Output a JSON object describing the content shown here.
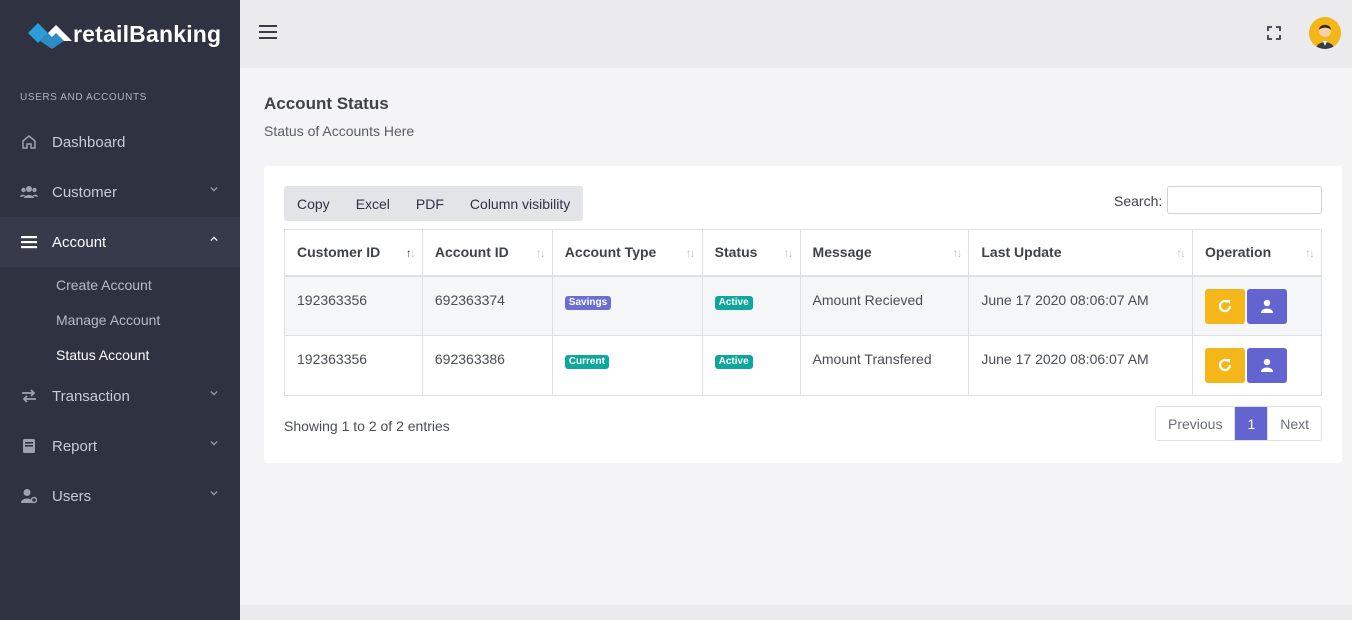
{
  "brand": {
    "name": "retailBanking",
    "accent": "#2d9cdb"
  },
  "sidebar": {
    "section_label": "USERS AND ACCOUNTS",
    "items": [
      {
        "label": "Dashboard",
        "icon": "home-icon"
      },
      {
        "label": "Customer",
        "icon": "users-group-icon"
      },
      {
        "label": "Account",
        "icon": "menu-bars-icon"
      },
      {
        "label": "Transaction",
        "icon": "exchange-icon"
      },
      {
        "label": "Report",
        "icon": "book-icon"
      },
      {
        "label": "Users",
        "icon": "user-cog-icon"
      }
    ],
    "account_sub": [
      {
        "label": "Create Account"
      },
      {
        "label": "Manage Account"
      },
      {
        "label": "Status Account"
      }
    ]
  },
  "page": {
    "title": "Account Status",
    "subtitle": "Status of Accounts Here"
  },
  "toolbar": {
    "copy": "Copy",
    "excel": "Excel",
    "pdf": "PDF",
    "column_visibility": "Column visibility",
    "search_label": "Search:",
    "search_value": ""
  },
  "table": {
    "headers": [
      "Customer ID",
      "Account ID",
      "Account Type",
      "Status",
      "Message",
      "Last Update",
      "Operation"
    ],
    "rows": [
      {
        "customer_id": "192363356",
        "account_id": "692363374",
        "account_type": "Savings",
        "status": "Active",
        "message": "Amount Recieved",
        "last_update": "June 17 2020 08:06:07 AM"
      },
      {
        "customer_id": "192363356",
        "account_id": "692363386",
        "account_type": "Current",
        "status": "Active",
        "message": "Amount Transfered",
        "last_update": "June 17 2020 08:06:07 AM"
      }
    ]
  },
  "footer": {
    "showing": "Showing 1 to 2 of 2 entries",
    "previous": "Previous",
    "page": "1",
    "next": "Next"
  },
  "colors": {
    "sidebar_bg": "#2f3241",
    "primary": "#6364d0",
    "warning": "#f5b619",
    "success": "#0da89b"
  }
}
